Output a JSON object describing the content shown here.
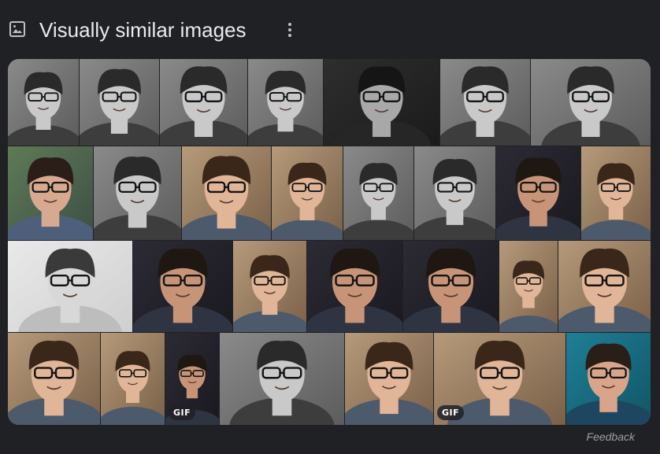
{
  "section": {
    "title": "Visually similar images",
    "section_icon": "image-icon",
    "more_icon": "more-vert-icon"
  },
  "feedback_label": "Feedback",
  "gif_label": "GIF",
  "colors": {
    "background": "#202124",
    "text": "#e8eaed",
    "muted": "#9aa0a6"
  },
  "tiles": [
    {
      "tone": "gray",
      "gif": false
    },
    {
      "tone": "gray",
      "gif": false
    },
    {
      "tone": "gray",
      "gif": false
    },
    {
      "tone": "gray",
      "gif": false
    },
    {
      "tone": "dark-gray",
      "gif": false
    },
    {
      "tone": "gray",
      "gif": false
    },
    {
      "tone": "gray",
      "gif": false
    },
    {
      "tone": "color-cool",
      "gif": false
    },
    {
      "tone": "gray",
      "gif": false
    },
    {
      "tone": "color-warm",
      "gif": false
    },
    {
      "tone": "color-warm",
      "gif": false
    },
    {
      "tone": "gray",
      "gif": false
    },
    {
      "tone": "gray",
      "gif": false
    },
    {
      "tone": "color-dark",
      "gif": false
    },
    {
      "tone": "color-warm",
      "gif": false
    },
    {
      "tone": "gray-light",
      "gif": false
    },
    {
      "tone": "color-dark",
      "gif": false
    },
    {
      "tone": "color-warm",
      "gif": false
    },
    {
      "tone": "color-dark",
      "gif": false
    },
    {
      "tone": "color-dark",
      "gif": false
    },
    {
      "tone": "color-warm",
      "gif": false
    },
    {
      "tone": "color-warm",
      "gif": false
    },
    {
      "tone": "color-warm",
      "gif": false
    },
    {
      "tone": "color-warm",
      "gif": false
    },
    {
      "tone": "color-dark",
      "gif": true
    },
    {
      "tone": "gray",
      "gif": false
    },
    {
      "tone": "color-warm",
      "gif": false
    },
    {
      "tone": "color-warm",
      "gif": true
    },
    {
      "tone": "color-teal",
      "gif": false
    }
  ]
}
